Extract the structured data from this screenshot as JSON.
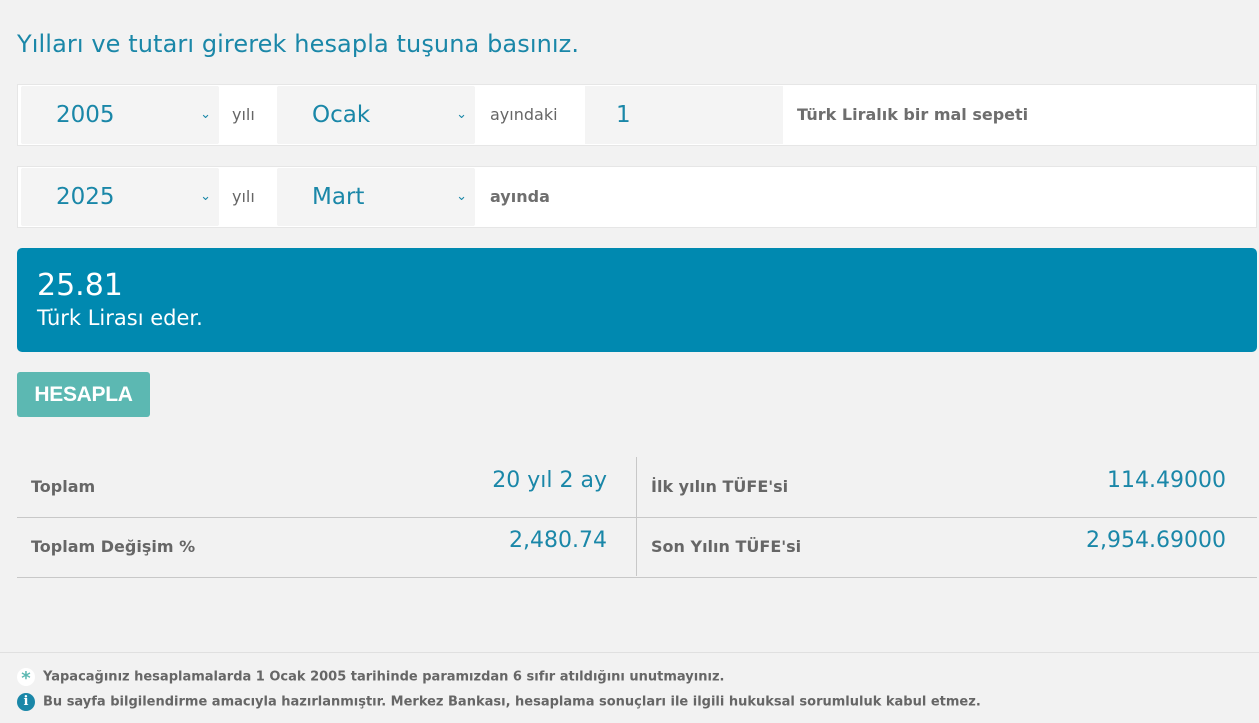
{
  "page": {
    "title": "Yılları ve tutarı girerek hesapla tuşuna basınız."
  },
  "from": {
    "year": "2005",
    "year_label": "yılı",
    "month": "Ocak",
    "month_label": "ayındaki",
    "amount": "1",
    "amount_label": "Türk Liralık bir mal sepeti"
  },
  "to": {
    "year": "2025",
    "year_label": "yılı",
    "month": "Mart",
    "month_label": "ayında"
  },
  "result": {
    "value": "25.81",
    "text": "Türk Lirası eder."
  },
  "button": {
    "label": "HESAPLA"
  },
  "stats": {
    "total_label": "Toplam",
    "total_value": "20 yıl 2 ay",
    "change_label": "Toplam Değişim %",
    "change_value": "2,480.74",
    "first_cpi_label": "İlk yılın TÜFE'si",
    "first_cpi_value": "114.49000",
    "last_cpi_label": "Son Yılın TÜFE'si",
    "last_cpi_value": "2,954.69000"
  },
  "notes": {
    "star_icon": "asterisk-icon",
    "info_icon": "info-icon",
    "note1": "Yapacağınız hesaplamalarda 1 Ocak 2005 tarihinde paramızdan 6 sıfır atıldığını unutmayınız.",
    "note2": "Bu sayfa bilgilendirme amacıyla hazırlanmıştır. Merkez Bankası, hesaplama sonuçları ile ilgili hukuksal sorumluluk kabul etmez."
  },
  "colors": {
    "accent": "#1a87a8",
    "result_bg": "#0089b0",
    "button_bg": "#5cb8b2",
    "page_bg": "#f2f2f2"
  }
}
